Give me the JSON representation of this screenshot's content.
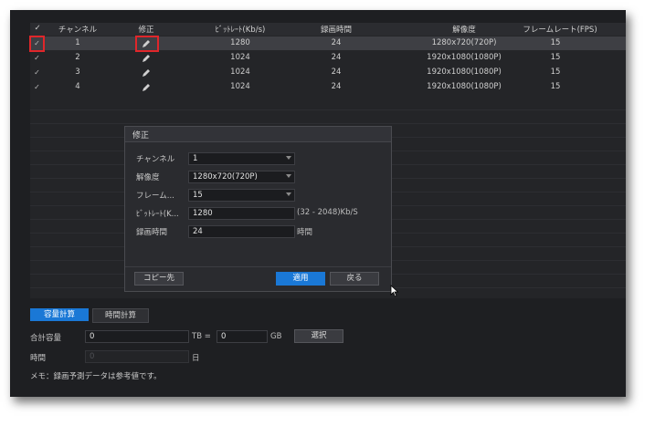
{
  "table": {
    "headers": {
      "check": "✓",
      "channel": "チャンネル",
      "edit": "修正",
      "bitrate": "ﾋﾞｯﾄﾚｰﾄ(Kb/s)",
      "rec_time": "録画時間",
      "resolution": "解像度",
      "framerate": "フレームレート(FPS)"
    },
    "rows": [
      {
        "check": "✓",
        "channel": "1",
        "bitrate": "1280",
        "rec_time": "24",
        "resolution": "1280x720(720P)",
        "framerate": "15"
      },
      {
        "check": "✓",
        "channel": "2",
        "bitrate": "1024",
        "rec_time": "24",
        "resolution": "1920x1080(1080P)",
        "framerate": "15"
      },
      {
        "check": "✓",
        "channel": "3",
        "bitrate": "1024",
        "rec_time": "24",
        "resolution": "1920x1080(1080P)",
        "framerate": "15"
      },
      {
        "check": "✓",
        "channel": "4",
        "bitrate": "1024",
        "rec_time": "24",
        "resolution": "1920x1080(1080P)",
        "framerate": "15"
      }
    ]
  },
  "dialog": {
    "title": "修正",
    "channel_label": "チャンネル",
    "channel_value": "1",
    "resolution_label": "解像度",
    "resolution_value": "1280x720(720P)",
    "framerate_label": "フレーム...",
    "framerate_value": "15",
    "bitrate_label": "ﾋﾞｯﾄﾚｰﾄ(K...",
    "bitrate_value": "1280",
    "bitrate_range": "(32 - 2048)Kb/S",
    "rectime_label": "録画時間",
    "rectime_value": "24",
    "rectime_unit": "時間",
    "copy_button": "コピー先",
    "apply_button": "適用",
    "back_button": "戻る"
  },
  "bottom": {
    "tab_capacity": "容量計算",
    "tab_time": "時間計算",
    "total_capacity_label": "合計容量",
    "total_capacity_value": "0",
    "tb_label": "TB =",
    "gb_value": "0",
    "gb_label": "GB",
    "select_button": "選択",
    "time_label": "時間",
    "time_value": "0",
    "day_label": "日",
    "memo": "メモ：録画予測データは参考値です。"
  },
  "colors": {
    "accent": "#1a78d6",
    "highlight": "#e0262a",
    "background": "#1e1f22"
  }
}
